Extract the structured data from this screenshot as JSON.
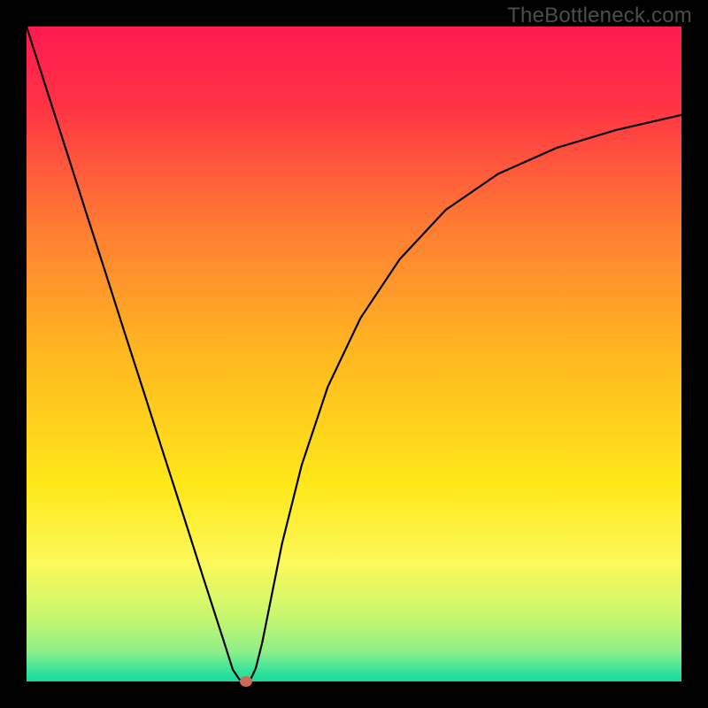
{
  "watermark": {
    "text": "TheBottleneck.com"
  },
  "chart_data": {
    "type": "line",
    "title": "",
    "xlabel": "",
    "ylabel": "",
    "xlim": [
      0,
      100
    ],
    "ylim": [
      0,
      100
    ],
    "grid": false,
    "legend": false,
    "background_gradient": {
      "type": "vertical",
      "stops": [
        {
          "offset": 0.0,
          "color": "#ff1a4f"
        },
        {
          "offset": 0.12,
          "color": "#ff3345"
        },
        {
          "offset": 0.3,
          "color": "#ff7a33"
        },
        {
          "offset": 0.5,
          "color": "#ffb820"
        },
        {
          "offset": 0.7,
          "color": "#ffe81a"
        },
        {
          "offset": 0.82,
          "color": "#fcf95a"
        },
        {
          "offset": 0.9,
          "color": "#c8f76e"
        },
        {
          "offset": 0.955,
          "color": "#8eee8a"
        },
        {
          "offset": 0.985,
          "color": "#32e39a"
        },
        {
          "offset": 1.0,
          "color": "#14dca0"
        }
      ]
    },
    "series": [
      {
        "name": "curve",
        "color": "#000000",
        "stroke_width": 2.2,
        "x": [
          0.0,
          3.0,
          6.0,
          9.0,
          12.0,
          15.0,
          18.0,
          21.0,
          24.0,
          27.0,
          30.0,
          31.5,
          32.5,
          33.3,
          33.8,
          34.2,
          35.0,
          36.0,
          37.2,
          39.0,
          42.0,
          46.0,
          51.0,
          57.0,
          64.0,
          72.0,
          81.0,
          90.0,
          100.0
        ],
        "y": [
          100.0,
          90.6,
          81.3,
          71.9,
          62.6,
          53.2,
          43.9,
          34.5,
          25.2,
          15.8,
          6.5,
          1.8,
          0.3,
          0.0,
          0.0,
          0.3,
          2.0,
          6.0,
          12.0,
          21.0,
          33.0,
          45.0,
          55.5,
          64.5,
          72.0,
          77.5,
          81.5,
          84.2,
          86.5
        ]
      }
    ],
    "marker": {
      "x": 33.5,
      "y": 0.0,
      "color": "#cc6a5a"
    }
  }
}
